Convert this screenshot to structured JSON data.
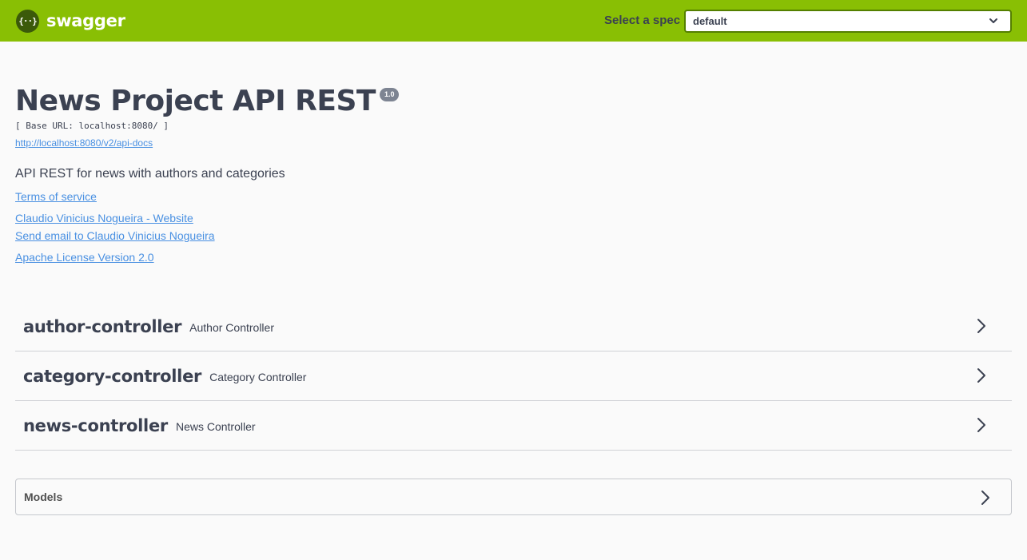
{
  "topbar": {
    "logo_mark": "{··}",
    "logo_text": "swagger",
    "spec_label": "Select a spec",
    "spec_value": "default",
    "colors": {
      "background": "#89bf04",
      "logo_mark": "#3b5a0a"
    }
  },
  "info": {
    "title": "News Project API REST",
    "version": "1.0",
    "base_url": "[ Base URL: localhost:8080/ ]",
    "docs_url": "http://localhost:8080/v2/api-docs",
    "description": "API REST for news with authors and categories",
    "terms": "Terms of service",
    "contact_website": "Claudio Vinicius Nogueira - Website",
    "contact_email": "Send email to Claudio Vinicius Nogueira",
    "license": "Apache License Version 2.0"
  },
  "tags": [
    {
      "name": "author-controller",
      "description": "Author Controller",
      "icon": "chevron-right-icon"
    },
    {
      "name": "category-controller",
      "description": "Category Controller",
      "icon": "chevron-right-icon"
    },
    {
      "name": "news-controller",
      "description": "News Controller",
      "icon": "chevron-right-icon"
    }
  ],
  "models": {
    "title": "Models",
    "icon": "chevron-right-icon"
  },
  "colors": {
    "link": "#4990e2",
    "text": "#3b4151"
  }
}
